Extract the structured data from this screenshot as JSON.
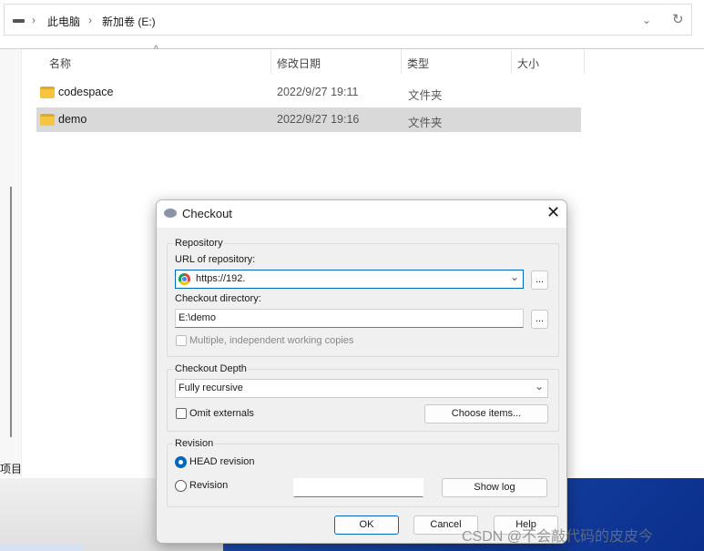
{
  "explorer": {
    "breadcrumb": [
      "此电脑",
      "新加卷 (E:)"
    ],
    "columns": [
      "名称",
      "修改日期",
      "类型",
      "大小"
    ],
    "rows": [
      {
        "name": "codespace",
        "date": "2022/9/27 19:11",
        "type": "文件夹",
        "selected": false
      },
      {
        "name": "demo",
        "date": "2022/9/27 19:16",
        "type": "文件夹",
        "selected": true
      }
    ],
    "status": "项目"
  },
  "dialog": {
    "title": "Checkout",
    "repository_group": "Repository",
    "url_label": "URL of repository:",
    "url_value": "https://192.",
    "dir_label": "Checkout directory:",
    "dir_value": "E:\\demo",
    "browse": "...",
    "multiple_label": "Multiple, independent working copies",
    "depth_group": "Checkout Depth",
    "depth_value": "Fully recursive",
    "omit_label": "Omit externals",
    "choose_items": "Choose items...",
    "revision_group": "Revision",
    "head_label": "HEAD revision",
    "revision_label": "Revision",
    "revision_value": "",
    "show_log": "Show log",
    "ok": "OK",
    "cancel": "Cancel",
    "help": "Help"
  },
  "watermark": "CSDN @不会敲代码的皮皮今",
  "colors": {
    "accent": "#0067c0",
    "desktop": "#1c4fb0"
  }
}
